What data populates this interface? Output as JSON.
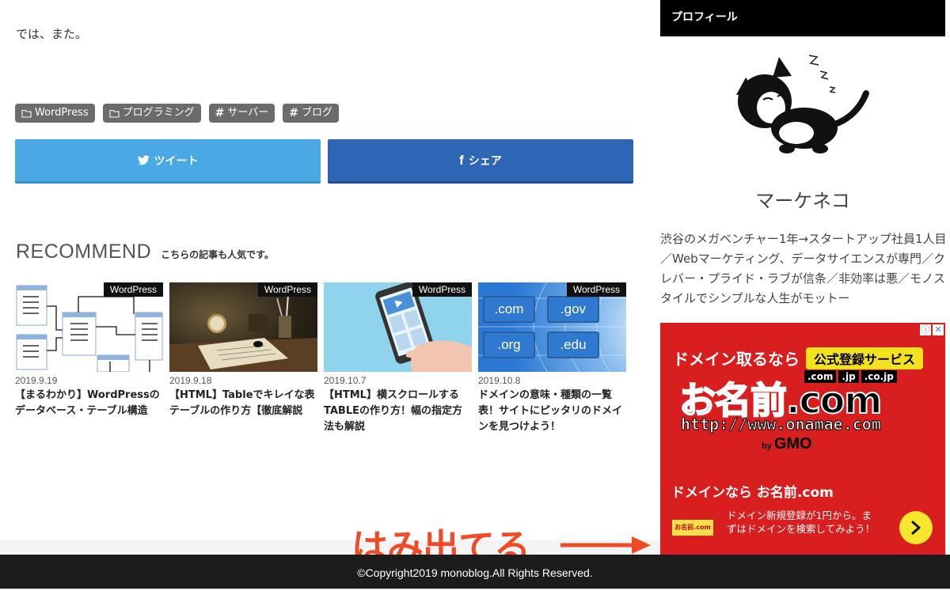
{
  "article": {
    "closing_text": "では、また。"
  },
  "tags": [
    {
      "icon": "folder-icon",
      "label": "WordPress"
    },
    {
      "icon": "folder-icon",
      "label": "プログラミング"
    },
    {
      "icon": "hashtag-icon",
      "label": "サーバー"
    },
    {
      "icon": "hashtag-icon",
      "label": "ブログ"
    }
  ],
  "share": {
    "tweet_label": "ツイート",
    "tweet_color": "#4aa8e4",
    "facebook_label": "シェア",
    "facebook_color": "#2f65b5"
  },
  "recommend": {
    "title": "RECOMMEND",
    "subtitle": "こちらの記事も人気です。",
    "cards": [
      {
        "category": "WordPress",
        "date": "2019.9.19",
        "title": "【まるわかり】WordPressのデータベース・テーブル構造"
      },
      {
        "category": "WordPress",
        "date": "2019.9.18",
        "title": "【HTML】Tableでキレイな表テーブルの作り方【徹底解説"
      },
      {
        "category": "WordPress",
        "date": "2019.10.7",
        "title": "【HTML】横スクロールするTABLEの作り方！幅の指定方法も解説"
      },
      {
        "category": "WordPress",
        "date": "2019.10.8",
        "title": "ドメインの意味・種類の一覧表！サイトにピッタリのドメインを見つけよう！"
      }
    ],
    "thumb4_labels": [
      ".com",
      ".gov",
      ".org",
      ".edu"
    ]
  },
  "sidebar": {
    "widget_title": "プロフィール",
    "name": "マーケネコ",
    "description": "渋谷のメガベンチャー1年→スタートアップ社員1人目／Webマーケティング、データサイエンスが専門／クレバー・プライド・ラブが信条／非効率は悪／モノスタイルでシンプルな人生がモットー"
  },
  "ad": {
    "line1": "ドメイン取るなら",
    "badge": "公式登録サービス",
    "domains": [
      ".com",
      ".jp",
      ".co.jp"
    ],
    "logo": "お名前.com",
    "url": "http://www.onamae.com",
    "by": "by",
    "gmo": "GMO",
    "headline": "ドメインなら お名前.com",
    "mini_logo": "お名前.com",
    "body": "ドメイン新規登録が1円から。まずはドメインを検索してみよう！",
    "info_icon": "ⓘ",
    "close_icon": "✕",
    "accent": "#d81e1e"
  },
  "annotation": {
    "text": "はみ出てる",
    "color": "#f04a26"
  },
  "footer": {
    "copyright": "©Copyright2019 monoblog.All Rights Reserved."
  }
}
